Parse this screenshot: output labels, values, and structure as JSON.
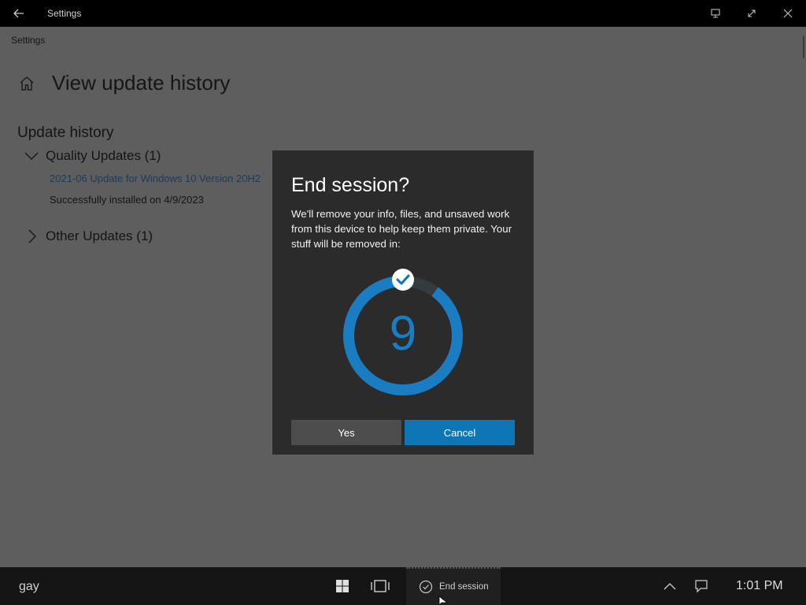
{
  "window": {
    "title": "Settings",
    "back_icon": "arrow-left-icon",
    "controls": [
      "restore-tablet-icon",
      "maximize-icon",
      "close-icon"
    ]
  },
  "settings": {
    "breadcrumb": "Settings",
    "page_title": "View update history",
    "section_title": "Update history",
    "quality_group": {
      "label": "Quality Updates (1)",
      "expanded": true,
      "items": [
        {
          "name": "2021-06 Update for Windows 10 Version 20H2",
          "status": "Successfully installed on 4/9/2023"
        }
      ]
    },
    "other_group": {
      "label": "Other Updates (1)",
      "expanded": false
    }
  },
  "dialog": {
    "title": "End session?",
    "message": "We'll remove your info, files, and unsaved work from this device to help keep them private. Your stuff will be removed in:",
    "countdown": "9",
    "countdown_progress": 0.9,
    "yes_label": "Yes",
    "cancel_label": "Cancel"
  },
  "taskbar": {
    "user": "gay",
    "session_label": "End session",
    "time": "1:01 PM"
  },
  "colors": {
    "accent": "#0f76b5",
    "ring": "#1a7dc2",
    "dialog_bg": "#2b2b2b",
    "overlay_bg": "#5e5e5e"
  }
}
